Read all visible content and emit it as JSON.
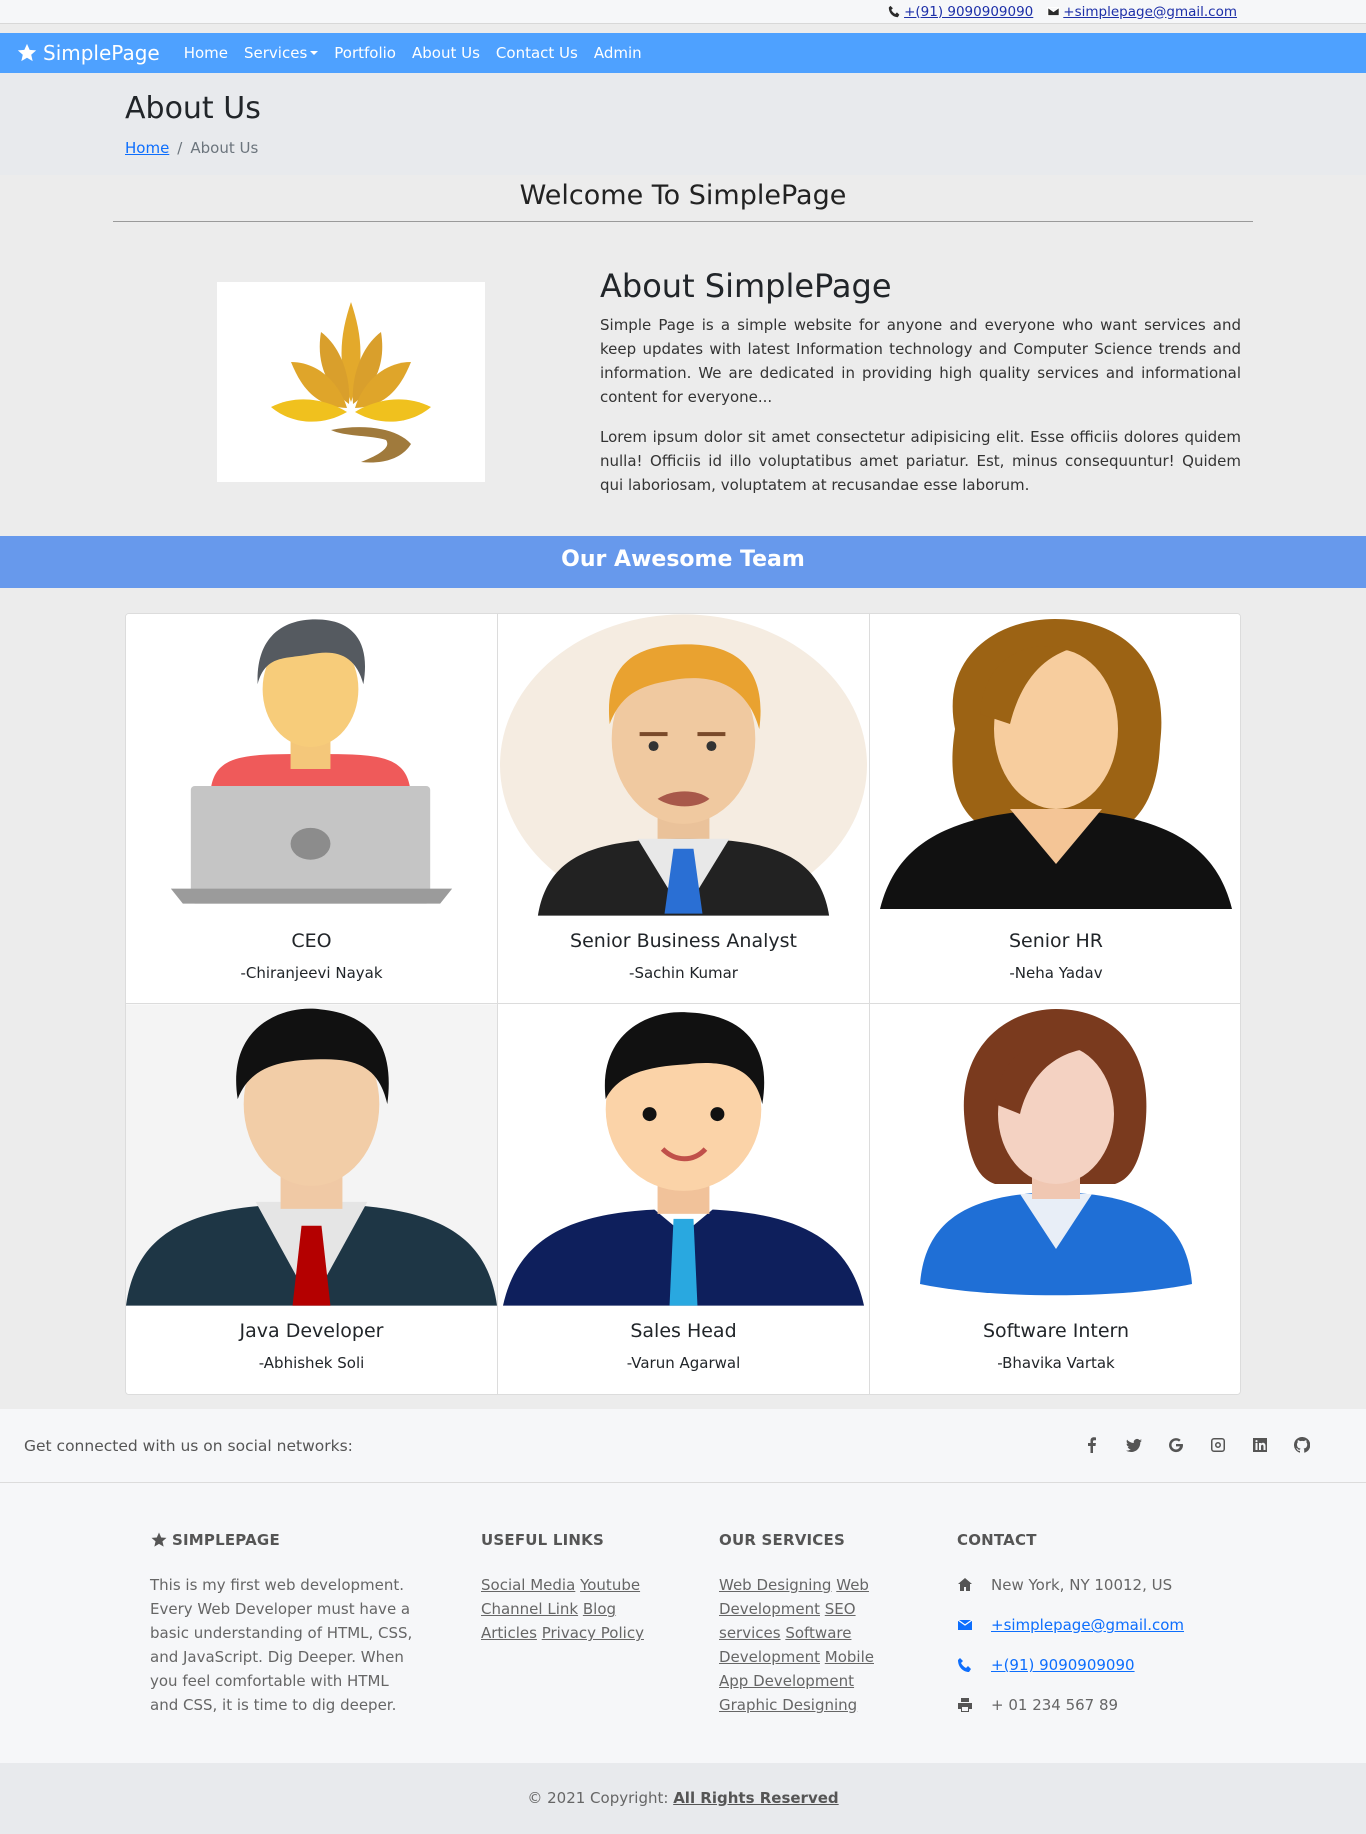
{
  "topbar": {
    "phone": "+(91) 9090909090",
    "email": "+simplepage@gmail.com"
  },
  "nav": {
    "brand": "SimplePage",
    "items": [
      "Home",
      "Services",
      "Portfolio",
      "About Us",
      "Contact Us",
      "Admin"
    ]
  },
  "header": {
    "title": "About Us",
    "breadcrumb_home": "Home",
    "breadcrumb_sep": "/",
    "breadcrumb_current": "About Us"
  },
  "welcome": "Welcome To SimplePage",
  "about": {
    "title": "About SimplePage",
    "p1": "Simple Page is a simple website for anyone and everyone who want services and keep updates with latest Information technology and Computer Science trends and information. We are dedicated in providing high quality services and informational content for everyone...",
    "p2": "Lorem ipsum dolor sit amet consectetur adipisicing elit. Esse officiis dolores quidem nulla! Officiis id illo voluptatibus amet pariatur. Est, minus consequuntur! Quidem qui laboriosam, voluptatem at recusandae esse laborum."
  },
  "team": {
    "heading": "Our Awesome Team",
    "members": [
      {
        "role": "CEO",
        "name": "-Chiranjeevi Nayak"
      },
      {
        "role": "Senior Business Analyst",
        "name": "-Sachin Kumar"
      },
      {
        "role": "Senior HR",
        "name": "-Neha Yadav"
      },
      {
        "role": "Java Developer",
        "name": "-Abhishek Soli"
      },
      {
        "role": "Sales Head",
        "name": "-Varun Agarwal"
      },
      {
        "role": "Software Intern",
        "name": "-Bhavika Vartak"
      }
    ]
  },
  "social": {
    "text": "Get connected with us on social networks:",
    "icons": [
      "facebook-icon",
      "twitter-icon",
      "google-icon",
      "instagram-icon",
      "linkedin-icon",
      "github-icon"
    ]
  },
  "footer": {
    "brand": "SIMPLEPAGE",
    "about": "This is my first web development. Every Web Developer must have a basic understanding of HTML, CSS, and JavaScript. Dig Deeper. When you feel comfortable with HTML and CSS, it is time to dig deeper.",
    "useful_heading": "USEFUL LINKS",
    "useful_links": [
      "Social Media",
      "Youtube",
      "Channel Link",
      "Blog",
      "Articles",
      "Privacy Policy"
    ],
    "services_heading": "OUR SERVICES",
    "services_links": [
      "Web Designing",
      "Web Development",
      "SEO services",
      "Software Development",
      "Mobile App Development",
      "Graphic Designing"
    ],
    "contact_heading": "CONTACT",
    "address": "New York, NY 10012, US",
    "email": "+simplepage@gmail.com",
    "phone": "+(91) 9090909090",
    "fax": "+ 01 234 567 89"
  },
  "copyright": {
    "prefix": "© 2021 Copyright:",
    "link": "All Rights Reserved"
  },
  "colors": {
    "navbar": "#4ea1ff",
    "team_band": "#6799ec",
    "link": "#0d6efd"
  }
}
